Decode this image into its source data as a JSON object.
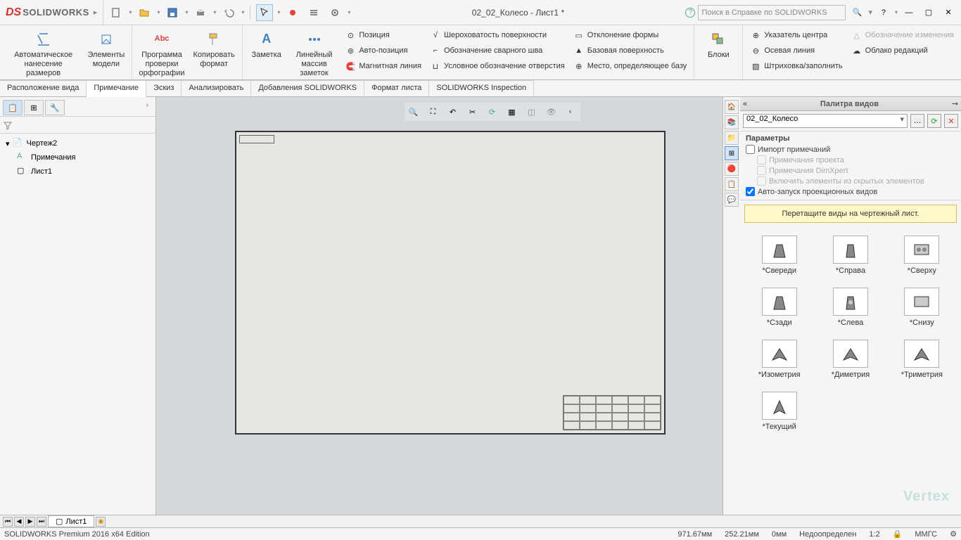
{
  "app": {
    "brand_prefix": "DS",
    "brand": "SOLIDWORKS",
    "title": "02_02_Колесо - Лист1 *",
    "search_placeholder": "Поиск в Справке по SOLIDWORKS"
  },
  "ribbon": {
    "auto_dim": "Автоматическое\nнанесение размеров",
    "model_items": "Элементы\nмодели",
    "spell_check": "Программа\nпроверки\nорфографии",
    "copy_format": "Копировать\nформат",
    "note": "Заметка",
    "linear_note_pattern": "Линейный\nмассив заметок",
    "position": "Позиция",
    "auto_position": "Авто-позиция",
    "magnetic_line": "Магнитная линия",
    "surface_roughness": "Шероховатость поверхности",
    "weld_symbol": "Обозначение сварного шва",
    "hole_callout": "Условное обозначение отверстия",
    "form_deviation": "Отклонение формы",
    "datum_surface": "Базовая поверхность",
    "datum_location": "Место, определяющее базу",
    "blocks": "Блоки",
    "center_marker": "Указатель центра",
    "center_line": "Осевая линия",
    "hatch_fill": "Штриховка/заполнить",
    "change_symbol": "Обозначение изменения",
    "revision_cloud": "Облако редакций"
  },
  "tabs": {
    "layout": "Расположение вида",
    "annotation": "Примечание",
    "sketch": "Эскиз",
    "analyze": "Анализировать",
    "addins": "Добавления SOLIDWORKS",
    "sheet_format": "Формат листа",
    "inspection": "SOLIDWORKS Inspection"
  },
  "tree": {
    "root": "Чертеж2",
    "annotations": "Примечания",
    "sheet": "Лист1"
  },
  "palette": {
    "title": "Палитра видов",
    "file_selected": "02_02_Колесо",
    "params_title": "Параметры",
    "import_annotations": "Импорт примечаний",
    "project_annotations": "Примечания проекта",
    "dimxpert_annotations": "Примечания DimXpert",
    "hidden_elements": "Включить элементы из скрытых элементов",
    "auto_projection": "Авто-запуск проекционных видов",
    "hint": "Перетащите виды на чертежный лист.",
    "views": [
      "*Свереди",
      "*Справа",
      "*Сверху",
      "*Сзади",
      "*Слева",
      "*Снизу",
      "*Изометрия",
      "*Диметрия",
      "*Триметрия",
      "*Текущий"
    ]
  },
  "bottom": {
    "sheet_tab": "Лист1"
  },
  "status": {
    "edition": "SOLIDWORKS Premium 2016 x64 Edition",
    "x": "971.67мм",
    "y": "252.21мм",
    "z": "0мм",
    "state": "Недоопределен",
    "scale": "1:2",
    "units": "ММГС"
  },
  "watermark": "Vertex"
}
